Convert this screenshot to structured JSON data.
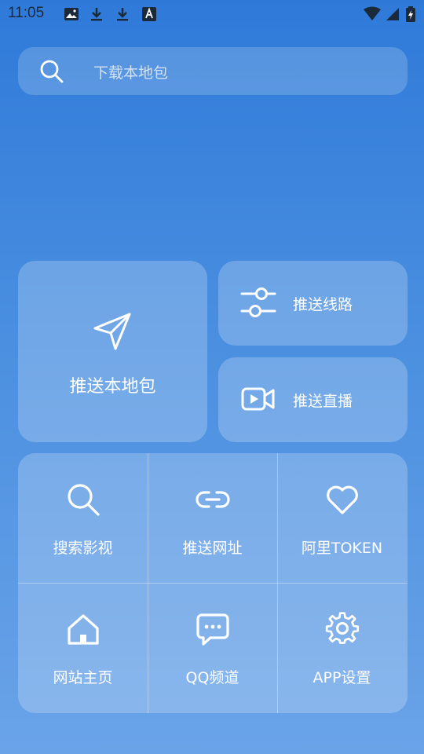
{
  "status_bar": {
    "time": "11:05",
    "icons": [
      "image-icon",
      "download-icon",
      "download-icon",
      "text-icon",
      "wifi-icon",
      "signal-icon",
      "battery-charging-icon"
    ]
  },
  "search": {
    "placeholder": "下载本地包",
    "icon": "search-icon"
  },
  "actions": {
    "push_local": {
      "label": "推送本地包",
      "icon": "send-icon"
    },
    "push_route": {
      "label": "推送线路",
      "icon": "sliders-icon"
    },
    "push_live": {
      "label": "推送直播",
      "icon": "video-icon"
    }
  },
  "grid": [
    {
      "label": "搜索影视",
      "icon": "search-icon"
    },
    {
      "label": "推送网址",
      "icon": "link-icon"
    },
    {
      "label": "阿里TOKEN",
      "icon": "heart-icon"
    },
    {
      "label": "网站主页",
      "icon": "home-icon"
    },
    {
      "label": "QQ频道",
      "icon": "chat-icon"
    },
    {
      "label": "APP设置",
      "icon": "gear-icon"
    }
  ],
  "colors": {
    "accent": "#2f7ad9",
    "card": "rgba(255,255,255,0.22)"
  }
}
